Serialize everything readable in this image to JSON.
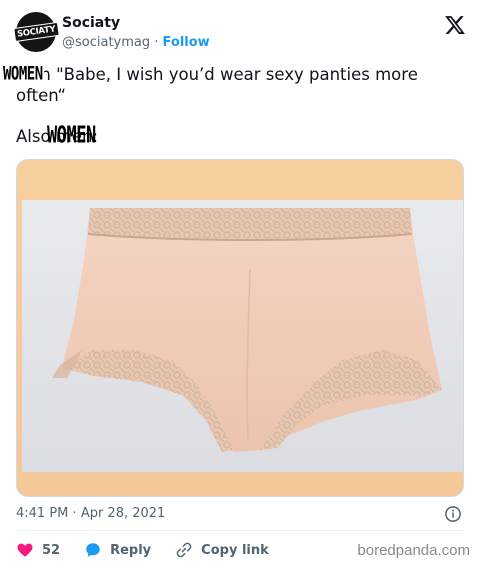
{
  "account": {
    "display_name": "Sociaty",
    "handle": "@sociatymag",
    "separator": "·",
    "follow_label": "Follow",
    "avatar_text": "SOCIATY"
  },
  "tweet": {
    "line1": "Men \"Babe, I wish you’d wear sexy panties more often“",
    "line2": "Also men:",
    "overlays": [
      "WOMEN",
      "WOMEN"
    ]
  },
  "meta": {
    "time": "4:41 PM",
    "separator": "·",
    "date": "Apr 28, 2021"
  },
  "actions": {
    "likes_count": "52",
    "reply_label": "Reply",
    "copy_link_label": "Copy link"
  },
  "watermark": "boredpanda.com",
  "colors": {
    "accent": "#1d9bf0",
    "heart": "#f91880",
    "text": "#0f1419",
    "muted": "#536471"
  },
  "icons": [
    "x-logo-icon",
    "info-icon",
    "heart-icon",
    "reply-bubble-icon",
    "link-icon"
  ]
}
